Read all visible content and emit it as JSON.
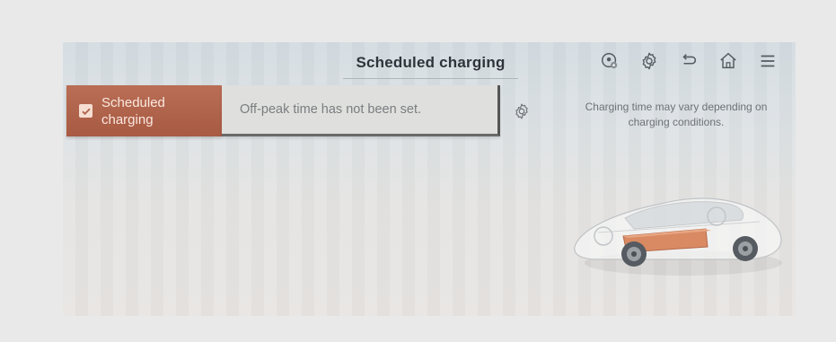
{
  "header": {
    "title": "Scheduled charging"
  },
  "toolbar": {
    "icons": [
      "location-icon",
      "settings-gear-icon",
      "back-icon",
      "home-icon",
      "menu-icon"
    ]
  },
  "scheduled": {
    "toggle_label_line1": "Scheduled",
    "toggle_label_line2": "charging",
    "checked": true,
    "status_text": "Off-peak time has not been set."
  },
  "note": {
    "line1": "Charging time may vary depending on",
    "line2": "charging conditions."
  },
  "colors": {
    "accent": "#b0624a",
    "title_text": "#2f343a",
    "status_text": "#7a7d80"
  }
}
